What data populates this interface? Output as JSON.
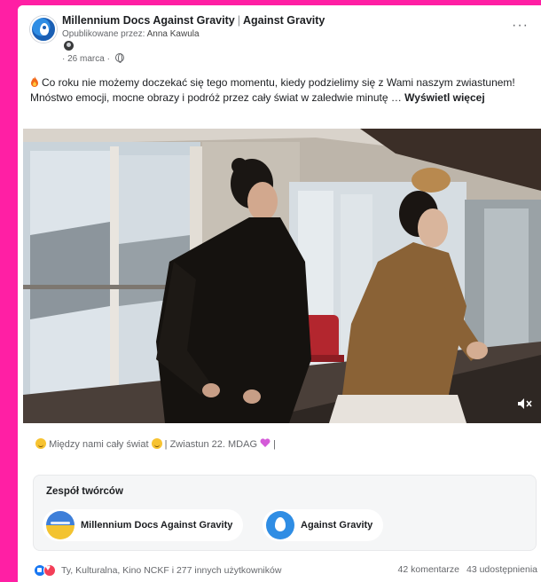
{
  "post": {
    "page_name": "Millennium Docs Against Gravity",
    "separator": "|",
    "co_page_name": "Against Gravity",
    "posted_by_label": "Opublikowane przez:",
    "posted_by_name": "Anna Kawula",
    "date": "26 marca",
    "text": "Co roku nie możemy doczekać się tego momentu, kiedy podzielimy się z Wami naszym zwiastunem! Mnóstwo emocji, mocne obrazy i podróż przez cały świat w zaledwie minutę …",
    "see_more": "Wyświetl więcej"
  },
  "video": {
    "caption_a": "Między nami cały świat",
    "caption_b": "| Zwiastun 22. MDAG",
    "caption_c": "|"
  },
  "creators": {
    "title": "Zespół twórców",
    "items": [
      {
        "name": "Millennium Docs Against Gravity"
      },
      {
        "name": "Against Gravity"
      }
    ]
  },
  "footer": {
    "reactors": "Ty, Kulturalna, Kino NCKF i 277 innych użytkowników",
    "comments": "42 komentarze",
    "shares": "43 udostępnienia"
  },
  "colors": {
    "frame": "#ff1fa4",
    "like": "#1877f2",
    "love": "#f33e58"
  },
  "icons": [
    "fire-icon",
    "globe-icon",
    "more-icon",
    "mute-icon",
    "smile-emoji",
    "heart-emoji",
    "like-reaction",
    "love-reaction"
  ]
}
